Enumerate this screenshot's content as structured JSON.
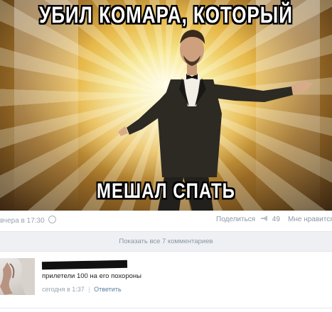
{
  "meme": {
    "top_caption": "УБИЛ КОМАРА, КОТОРЫЙ",
    "bottom_caption": "МЕШАЛ СПАТЬ"
  },
  "post_meta": {
    "time": "вчера в 17:30",
    "share_label": "Поделиться",
    "share_count": "49",
    "like_label": "Мне нравится"
  },
  "comments_bar": {
    "show_all_label": "Показать все 7 комментариев"
  },
  "comment": {
    "text": "прилетели 100 на его похороны",
    "time": "сегодня в 1:37",
    "separator": "|",
    "reply_label": "Ответить"
  },
  "colors": {
    "link": "#5a7ea3",
    "meta_text": "#9aa4b0",
    "bar_bg": "#eef0f3"
  }
}
